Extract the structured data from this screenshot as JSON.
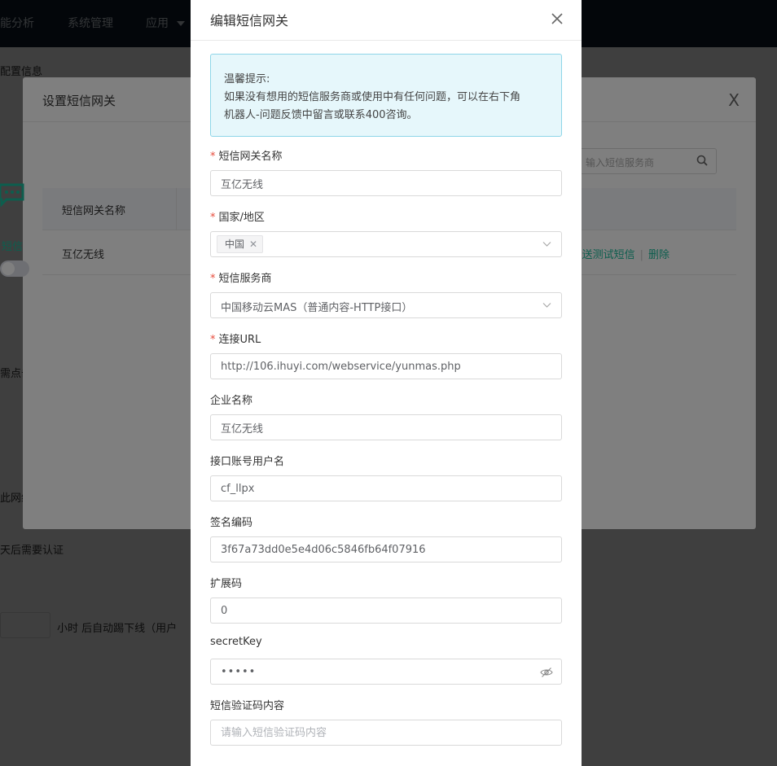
{
  "app": {
    "nav": [
      "能分析",
      "系统管理",
      "应用"
    ],
    "config_info": "配置信息",
    "bg_left_1": "需点击",
    "bg_left_2": "此网络",
    "bg_auth": "天后需要认证",
    "bg_kick": "小时 后自动踢下线（用户"
  },
  "gateway_dialog": {
    "title": "设置短信网关",
    "close_label": "X",
    "search_placeholder": "输入短信服务商",
    "column_name": "短信网关名称",
    "row_name": "互亿无线",
    "row_action_test": "发送测试短信",
    "row_action_delete": "删除",
    "side_label": "短信"
  },
  "edit_dialog": {
    "title": "编辑短信网关",
    "tip": {
      "heading": "温馨提示:",
      "line1": "如果没有想用的短信服务商或使用中有任何问题，可以在右下角",
      "line2": "机器人-问题反馈中留言或联系400咨询。"
    },
    "fields": {
      "gateway_name": {
        "label": "短信网关名称",
        "required": true,
        "value": "互亿无线"
      },
      "country": {
        "label": "国家/地区",
        "required": true,
        "tag": "中国"
      },
      "provider": {
        "label": "短信服务商",
        "required": true,
        "value": "中国移动云MAS（普通内容-HTTP接口）"
      },
      "url": {
        "label": "连接URL",
        "required": true,
        "value": "http://106.ihuyi.com/webservice/yunmas.php"
      },
      "company": {
        "label": "企业名称",
        "value": "互亿无线"
      },
      "username": {
        "label": "接口账号用户名",
        "value": "cf_llpx"
      },
      "sign_code": {
        "label": "签名编码",
        "value": "3f67a73dd0e5e4d06c5846fb64f07916"
      },
      "ext_code": {
        "label": "扩展码",
        "value": "0"
      },
      "secret_key": {
        "label": "secretKey",
        "value": "•••••"
      },
      "sms_content": {
        "label": "短信验证码内容",
        "placeholder": "请输入短信验证码内容"
      }
    }
  },
  "colors": {
    "accent": "#1abc9c",
    "required": "#e74c3c",
    "topbar": "#0d1b2a"
  }
}
